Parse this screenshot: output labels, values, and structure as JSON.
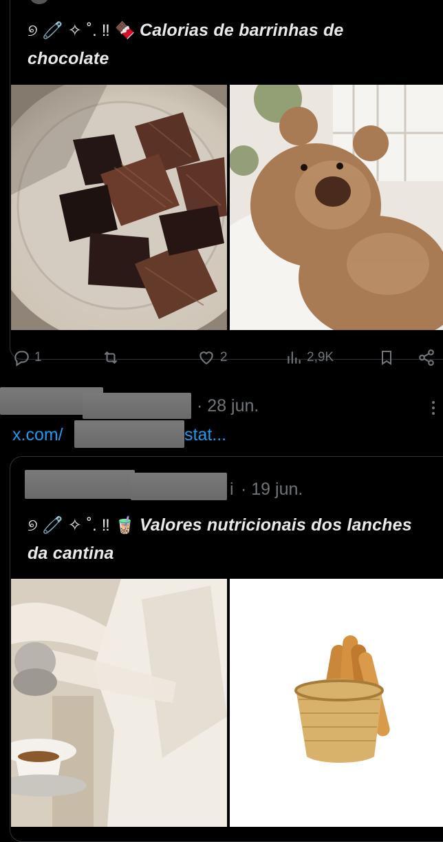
{
  "tweet1": {
    "deco": "୭ 🧷 ✧ ˚. ‼ 🍫",
    "text": "Calorias de barrinhas de chocolate",
    "actions": {
      "replies": "1",
      "retweets": "",
      "likes": "2",
      "views": "2,9K"
    },
    "images": [
      "chocolate-squares-photo",
      "teddy-bear-photo"
    ]
  },
  "reply": {
    "date": "· 28 jun.",
    "link_prefix": "x.com/",
    "link_suffix": "stat..."
  },
  "tweet2": {
    "handle_suffix": "i",
    "date": "· 19 jun.",
    "deco": "୭ 🧷 ✧ ˚. ‼ 🧋",
    "text": "Valores nutricionais dos lanches da cantina",
    "images": [
      "tea-pouring-photo",
      "bread-basket-photo"
    ]
  },
  "colors": {
    "background": "#000000",
    "text": "#e7e9ea",
    "muted": "#71767b",
    "link": "#1d9bf0",
    "border": "#2f3336"
  }
}
